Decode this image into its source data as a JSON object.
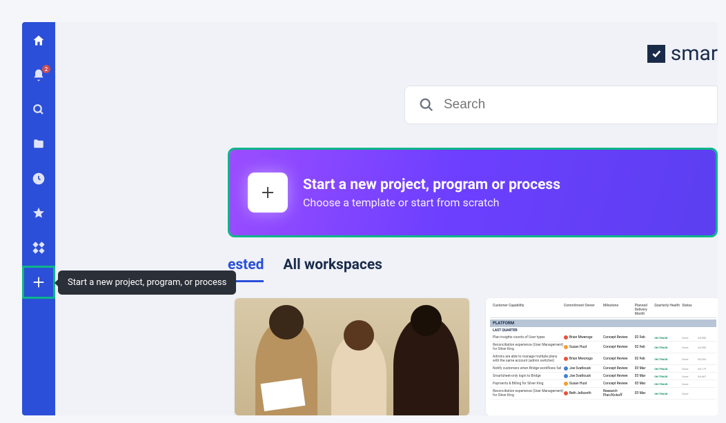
{
  "logo_text": "smar",
  "search": {
    "placeholder": "Search"
  },
  "sidebar": {
    "home": "home",
    "notifications": "notifications",
    "notification_count": "2",
    "search": "search",
    "folder": "folder",
    "recent": "recent",
    "favorites": "favorites",
    "apps": "apps"
  },
  "hero": {
    "title": "Start a new project, program or process",
    "subtitle": "Choose a template or start from scratch"
  },
  "tooltip": "Start a new project, program, or process",
  "tabs": {
    "suggested": "Suggested",
    "suggested_visible": "ested",
    "all_workspaces": "All workspaces"
  },
  "sheet": {
    "headers": [
      "Customer Capability",
      "Commitment Owner",
      "Milestone",
      "Planned Delivery Month",
      "Quarterly Health",
      "Status",
      ""
    ],
    "section": "PLATFORM",
    "subsection": "LAST QUARTER",
    "rows": [
      {
        "cap": "Plan insights counts of User types",
        "owner": "Brian Mwerogo",
        "milestone": "Concept Review",
        "month": "02 Feb",
        "health": "ON TRACK",
        "status": "Done",
        "amt": "65,550"
      },
      {
        "cap": "Reconciliation experience (User Management) for Silver King",
        "owner": "Susan Hust",
        "milestone": "Concept Review",
        "month": "02 Feb",
        "health": "ON TRACK",
        "status": "Done",
        "amt": "46,550"
      },
      {
        "cap": "Admins are able to manage multiple plans with the same account (admin switcher)",
        "owner": "Brian Mworogo",
        "milestone": "Concept Review",
        "month": "02 Feb",
        "health": "ON TRACK",
        "status": "Done",
        "amt": "56,204"
      },
      {
        "cap": "Notify customers when Bridge workflows fail",
        "owner": "Joe Svatlousk",
        "milestone": "Concept Review",
        "month": "03 Mar",
        "health": "ON TRACK",
        "status": "Done",
        "amt": "38,179"
      },
      {
        "cap": "Smartsheet-only login to Bridge",
        "owner": "Joe Svatlousk",
        "milestone": "Concept Review",
        "month": "03 Mar",
        "health": "ON TRACK",
        "status": "Done",
        "amt": "84,467"
      },
      {
        "cap": "Payments & Billing for Silver King",
        "owner": "Susan Hust",
        "milestone": "Concept Review",
        "month": "03 Mar",
        "health": "ON TRACK",
        "status": "Done",
        "amt": ""
      },
      {
        "cap": "Reconciliation experience (User Management) for Silver King",
        "owner": "Beth Jellsonth",
        "milestone": "Research Plan/Kickoff",
        "month": "03 Mar",
        "health": "ON TRACK",
        "status": "Done",
        "amt": ""
      }
    ]
  }
}
